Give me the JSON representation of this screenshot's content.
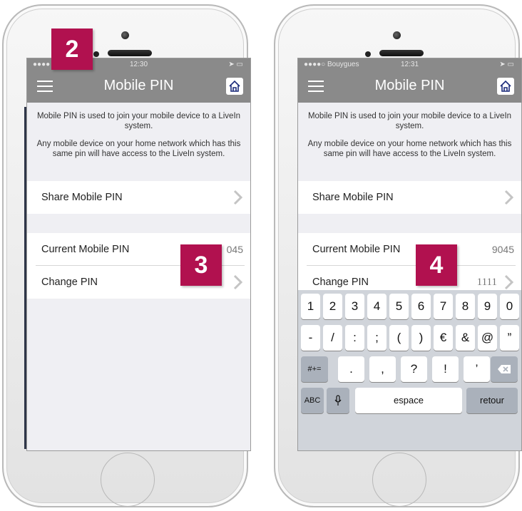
{
  "colors": {
    "navbar": "#8a8a8a",
    "badge": "#b1114f",
    "background": "#efeff3"
  },
  "left": {
    "status_carrier": "●●●●",
    "status_time": "12:30",
    "nav_title": "Mobile PIN",
    "info_1": "Mobile PIN is used to join your mobile device to a LiveIn system.",
    "info_2": "Any mobile device on your home network which has this same pin will have access to the LiveIn system.",
    "share_label": "Share Mobile PIN",
    "current_label": "Current Mobile PIN",
    "current_value": "045",
    "change_label": "Change PIN"
  },
  "right": {
    "status_carrier": "●●●●○ Bouygues",
    "status_time": "12:31",
    "nav_title": "Mobile PIN",
    "info_1": "Mobile PIN is used to join your mobile device to a LiveIn system.",
    "info_2": "Any mobile device on your home network which has this same pin will have access to the LiveIn system.",
    "share_label": "Share Mobile PIN",
    "current_label": "Current Mobile PIN",
    "current_value": "9045",
    "change_label": "Change PIN",
    "change_value": "1111"
  },
  "keyboard": {
    "row1": [
      "1",
      "2",
      "3",
      "4",
      "5",
      "6",
      "7",
      "8",
      "9",
      "0"
    ],
    "row2": [
      "-",
      "/",
      ":",
      ";",
      "(",
      ")",
      "€",
      "&",
      "@",
      "”"
    ],
    "row3": [
      ".",
      ",",
      "?",
      "!",
      "’"
    ],
    "symbols_key": "#+=",
    "abc_key": "ABC",
    "space_key": "espace",
    "return_key": "retour"
  },
  "badges": {
    "b2": "2",
    "b3": "3",
    "b4": "4"
  }
}
